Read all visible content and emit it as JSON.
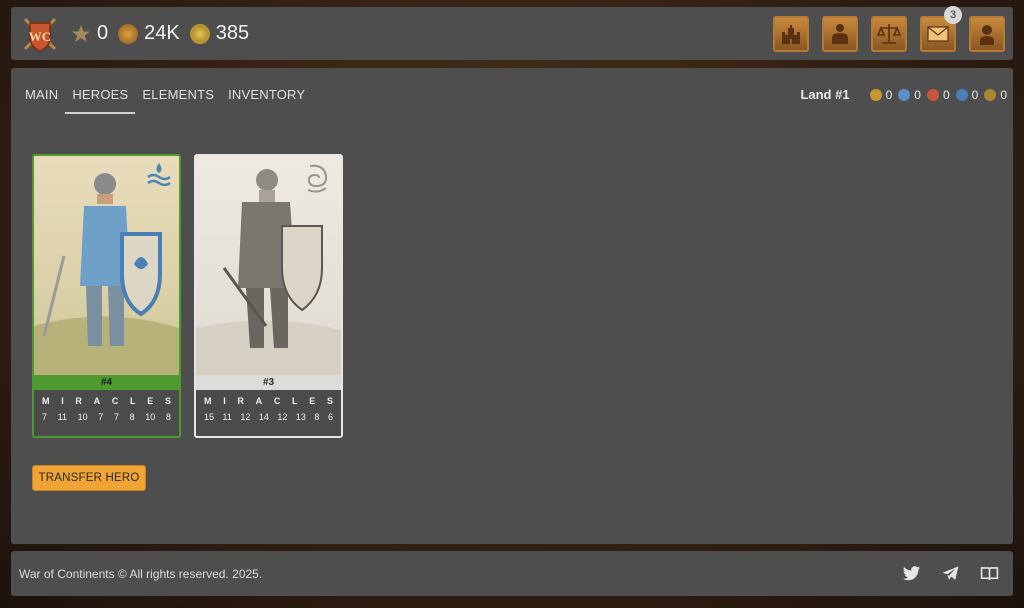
{
  "topbar": {
    "stats": [
      {
        "icon": "vip-star-icon",
        "value": "0"
      },
      {
        "icon": "gold-medal-icon",
        "value": "24K"
      },
      {
        "icon": "coin-icon",
        "value": "385"
      }
    ],
    "nav": [
      {
        "icon": "castle-icon"
      },
      {
        "icon": "hero-icon"
      },
      {
        "icon": "scales-icon"
      },
      {
        "icon": "mail-icon",
        "badge": "3"
      },
      {
        "icon": "profile-icon"
      }
    ]
  },
  "tabs": [
    "MAIN",
    "HEROES",
    "ELEMENTS",
    "INVENTORY"
  ],
  "active_tab": "HEROES",
  "land": {
    "label": "Land #1",
    "resources": [
      {
        "icon": "gold-resource-icon",
        "value": "0",
        "color": "#c7962f"
      },
      {
        "icon": "water-resource-icon",
        "value": "0",
        "color": "#5a8fc9"
      },
      {
        "icon": "fire-resource-icon",
        "value": "0",
        "color": "#c9553a"
      },
      {
        "icon": "air-resource-icon",
        "value": "0",
        "color": "#4d7fb8"
      },
      {
        "icon": "earth-resource-icon",
        "value": "0",
        "color": "#a9872f"
      }
    ]
  },
  "cards": [
    {
      "id": "#4",
      "element_icon": "water-element-icon",
      "letters": [
        "M",
        "I",
        "R",
        "A",
        "C",
        "L",
        "E",
        "S"
      ],
      "values": [
        "7",
        "11",
        "10",
        "7",
        "7",
        "8",
        "10",
        "8"
      ]
    },
    {
      "id": "#3",
      "element_icon": "air-element-icon",
      "letters": [
        "M",
        "I",
        "R",
        "A",
        "C",
        "L",
        "E",
        "S"
      ],
      "values": [
        "15",
        "11",
        "12",
        "14",
        "12",
        "13",
        "8",
        "6"
      ]
    }
  ],
  "transfer_label": "TRANSFER HERO",
  "footer": {
    "copyright": "War of Continents © All rights reserved. 2025.",
    "social": [
      "twitter-icon",
      "telegram-icon",
      "book-icon"
    ]
  },
  "colors": {
    "accent": "#f0a436",
    "panel": "#4e4e4e",
    "green_border": "#4e9a2e"
  }
}
